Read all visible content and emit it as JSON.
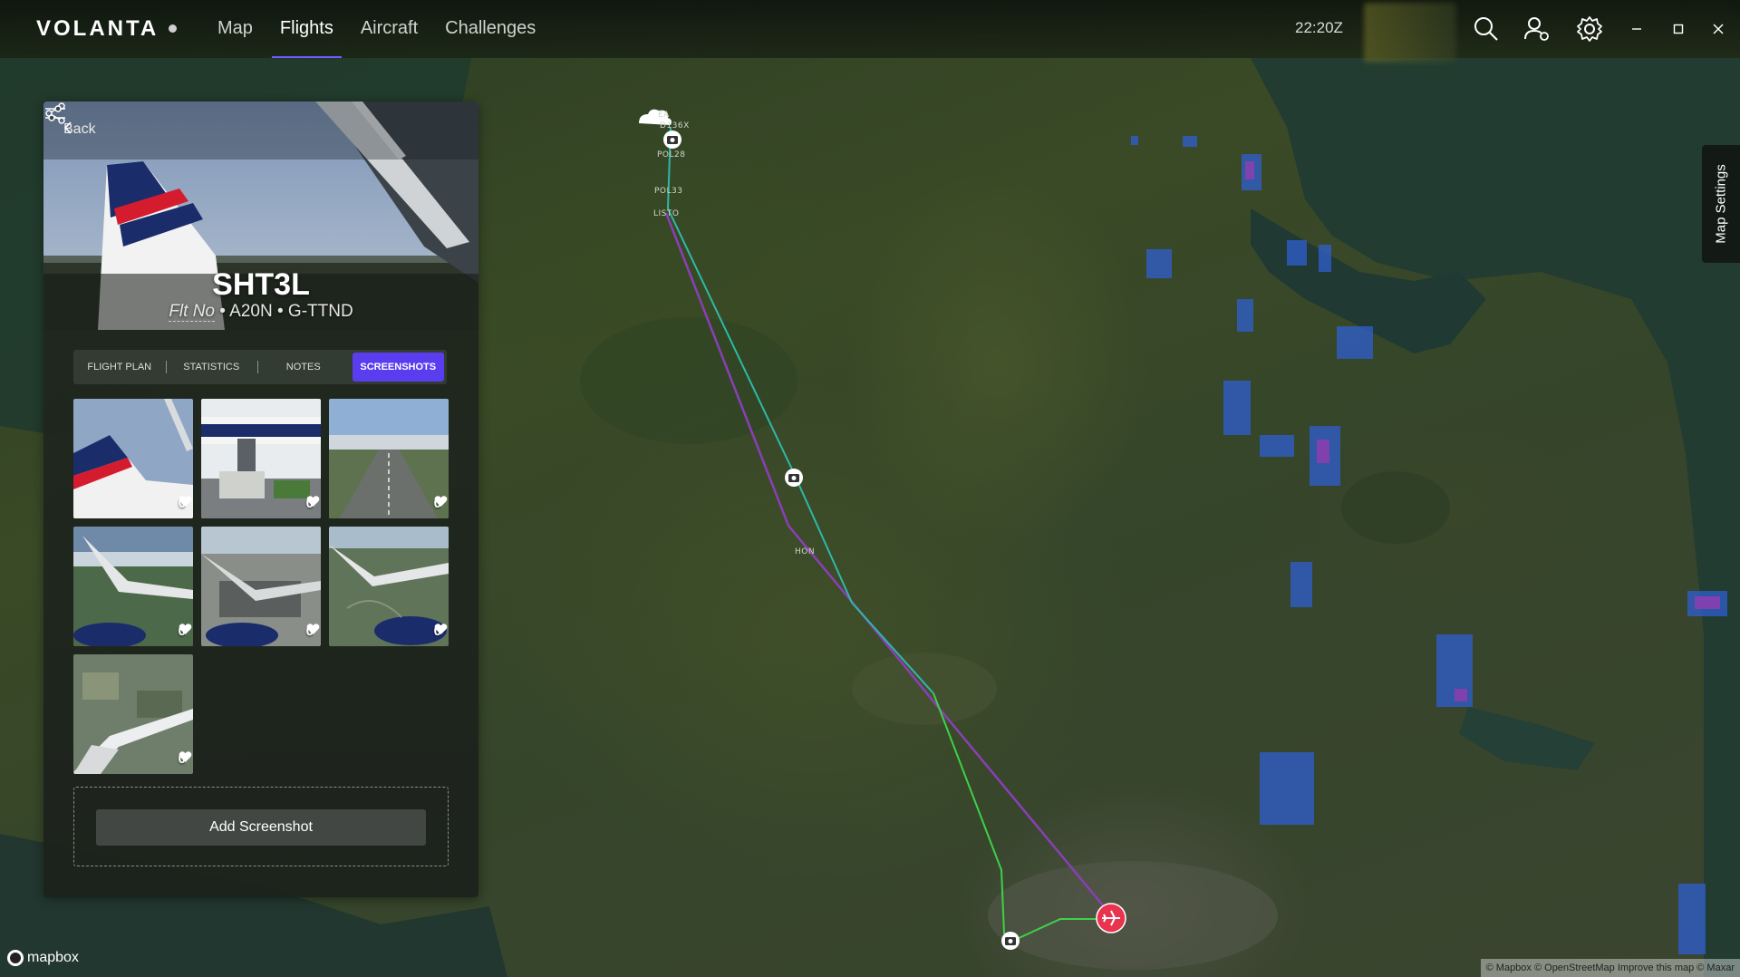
{
  "app": {
    "logo": "VOLANTA",
    "time": "22:20Z"
  },
  "nav": {
    "items": [
      {
        "label": "Map"
      },
      {
        "label": "Flights"
      },
      {
        "label": "Aircraft"
      },
      {
        "label": "Challenges"
      }
    ],
    "active": "Flights"
  },
  "toolbar_icons": [
    "search-icon",
    "user-icon",
    "gear-icon",
    "minimize-icon",
    "maximize-icon",
    "close-icon"
  ],
  "panel": {
    "back_label": "Back",
    "callsign": "SHT3L",
    "flt_no": "Flt No",
    "separator": "•",
    "aircraft_type": "A20N",
    "registration": "G-TTND",
    "tabs": [
      {
        "label": "FLIGHT PLAN"
      },
      {
        "label": "STATISTICS"
      },
      {
        "label": "NOTES"
      },
      {
        "label": "SCREENSHOTS"
      }
    ],
    "active_tab": "SCREENSHOTS",
    "screenshots": [
      {
        "likes": "0"
      },
      {
        "likes": "0"
      },
      {
        "likes": "0"
      },
      {
        "likes": "0"
      },
      {
        "likes": "0"
      },
      {
        "likes": "0"
      },
      {
        "likes": "0"
      }
    ],
    "add_screenshot_label": "Add Screenshot"
  },
  "map": {
    "waypoints": [
      "EA",
      "D136X",
      "POL28",
      "POL33",
      "LISTO",
      "HON"
    ],
    "settings_label": "Map Settings",
    "mapbox_label": "mapbox",
    "attribution": "© Mapbox © OpenStreetMap Improve this map © Maxar"
  },
  "colors": {
    "accent": "#5b3df0",
    "route_planned": "#8a3fb8",
    "route_flown_cyan": "#2fb8a8",
    "route_flown_green": "#3fd04a",
    "destination_marker": "#e8344e",
    "precip_blue": "#2f5fd0",
    "precip_purple": "#8a3fb0"
  }
}
